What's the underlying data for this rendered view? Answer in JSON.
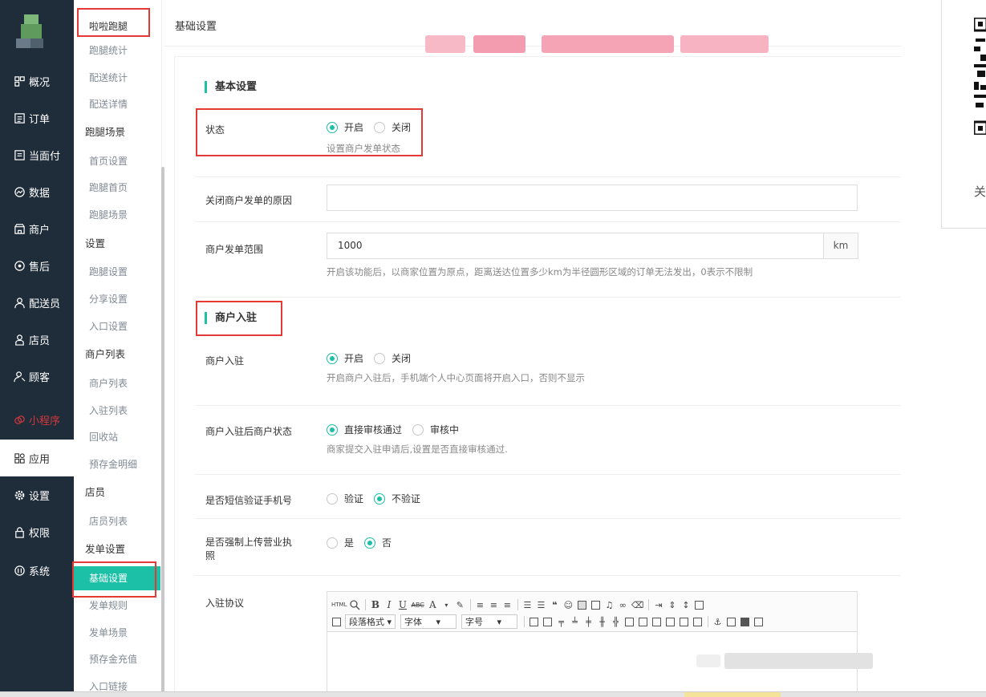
{
  "header": {
    "breadcrumb": "基础设置"
  },
  "nav": {
    "items": [
      {
        "label": "概况",
        "icon": "dashboard-icon"
      },
      {
        "label": "订单",
        "icon": "order-icon"
      },
      {
        "label": "当面付",
        "icon": "pay-icon"
      },
      {
        "label": "数据",
        "icon": "data-icon"
      },
      {
        "label": "商户",
        "icon": "shop-icon"
      },
      {
        "label": "售后",
        "icon": "aftersale-icon"
      },
      {
        "label": "配送员",
        "icon": "courier-icon"
      },
      {
        "label": "店员",
        "icon": "clerk-icon"
      },
      {
        "label": "顾客",
        "icon": "customer-icon"
      },
      {
        "label": "小程序",
        "icon": "miniprogram-icon"
      },
      {
        "label": "应用",
        "icon": "apps-icon"
      },
      {
        "label": "设置",
        "icon": "settings-icon"
      },
      {
        "label": "权限",
        "icon": "lock-icon"
      },
      {
        "label": "系统",
        "icon": "system-icon"
      }
    ]
  },
  "subnav": {
    "title": "啦啦跑腿",
    "items": [
      {
        "label": "跑腿统计",
        "type": "link"
      },
      {
        "label": "配送统计",
        "type": "link"
      },
      {
        "label": "配送详情",
        "type": "link"
      },
      {
        "label": "跑腿场景",
        "type": "group"
      },
      {
        "label": "首页设置",
        "type": "link"
      },
      {
        "label": "跑腿首页",
        "type": "link"
      },
      {
        "label": "跑腿场景",
        "type": "link"
      },
      {
        "label": "设置",
        "type": "group"
      },
      {
        "label": "跑腿设置",
        "type": "link"
      },
      {
        "label": "分享设置",
        "type": "link"
      },
      {
        "label": "入口设置",
        "type": "link"
      },
      {
        "label": "商户列表",
        "type": "group"
      },
      {
        "label": "商户列表",
        "type": "link"
      },
      {
        "label": "入驻列表",
        "type": "link"
      },
      {
        "label": "回收站",
        "type": "link"
      },
      {
        "label": "预存金明细",
        "type": "link"
      },
      {
        "label": "店员",
        "type": "group"
      },
      {
        "label": "店员列表",
        "type": "link"
      },
      {
        "label": "发单设置",
        "type": "group"
      },
      {
        "label": "基础设置",
        "type": "selected"
      },
      {
        "label": "发单规则",
        "type": "link"
      },
      {
        "label": "发单场景",
        "type": "link"
      },
      {
        "label": "预存金充值",
        "type": "link"
      },
      {
        "label": "入口链接",
        "type": "link"
      }
    ]
  },
  "form": {
    "section_basic": "基本设置",
    "status": {
      "label": "状态",
      "options": [
        "开启",
        "关闭"
      ],
      "help": "设置商户发单状态"
    },
    "close_reason": {
      "label": "关闭商户发单的原因",
      "value": ""
    },
    "range": {
      "label": "商户发单范围",
      "value": "1000",
      "unit": "km",
      "help": "开启该功能后，以商家位置为原点，距离送达位置多少km为半径圆形区域的订单无法发出，0表示不限制"
    },
    "section_join": "商户入驻",
    "join": {
      "label": "商户入驻",
      "options": [
        "开启",
        "关闭"
      ],
      "help": "开启商户入驻后，手机端个人中心页面将开启入口，否则不显示"
    },
    "join_status": {
      "label": "商户入驻后商户状态",
      "options": [
        "直接审核通过",
        "审核中"
      ],
      "help": "商家提交入驻申请后,设置是否直接审核通过."
    },
    "sms_verify": {
      "label": "是否短信验证手机号",
      "options": [
        "验证",
        "不验证"
      ]
    },
    "license": {
      "label_line1": "是否强制上传营业执",
      "label_line2": "照",
      "options": [
        "是",
        "否"
      ]
    },
    "agreement": {
      "label": "入驻协议"
    }
  },
  "editor": {
    "html_label": "HTML",
    "bold": "B",
    "italic": "I",
    "underline": "U",
    "strike": "ABC",
    "font_color": "A",
    "paragraph": "段落格式",
    "font": "字体",
    "size": "字号"
  },
  "rightpanel": {
    "text": "关"
  }
}
